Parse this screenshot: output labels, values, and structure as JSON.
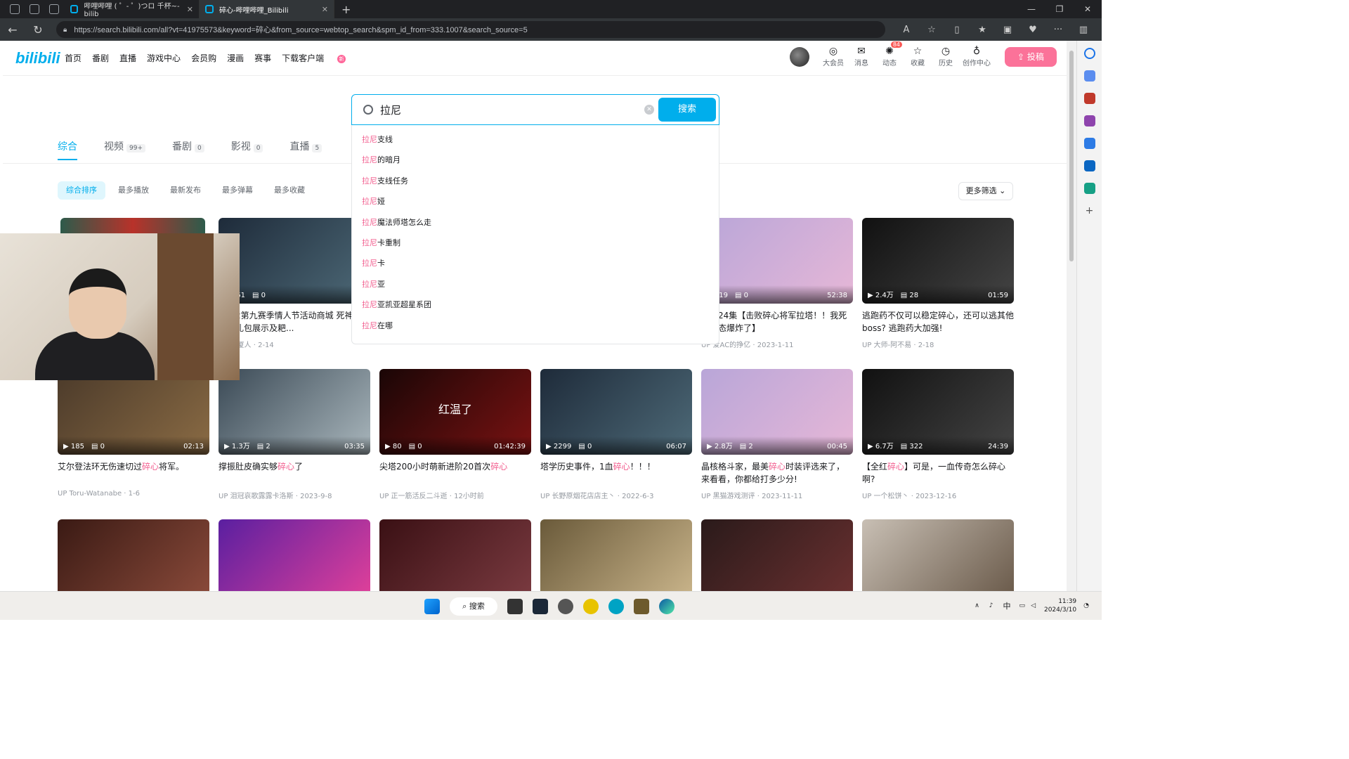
{
  "browser": {
    "tabs": [
      {
        "title": "哔哩哔哩 ( ゜- ゜)つロ 千杯~-bilib",
        "active": false
      },
      {
        "title": "碎心-哔哩哔哩_Bilibili",
        "active": true
      }
    ],
    "url": "https://search.bilibili.com/all?vt=41975573&keyword=碎心&from_source=webtop_search&spm_id_from=333.1007&search_source=5"
  },
  "header": {
    "logo": "bilibili",
    "nav": [
      "首页",
      "番剧",
      "直播",
      "游戏中心",
      "会员购",
      "漫画",
      "赛事",
      "下载客户端"
    ],
    "nav_badge": "新",
    "right_icons": [
      {
        "label": "大会员",
        "icon": "vip-icon"
      },
      {
        "label": "消息",
        "icon": "message-icon"
      },
      {
        "label": "动态",
        "icon": "dynamic-icon",
        "count": "84"
      },
      {
        "label": "收藏",
        "icon": "star-icon"
      },
      {
        "label": "历史",
        "icon": "clock-icon"
      },
      {
        "label": "创作中心",
        "icon": "bulb-icon"
      }
    ],
    "upload": "投稿"
  },
  "search": {
    "query": "拉尼",
    "button": "搜索",
    "suggestions": [
      {
        "hl": "拉尼",
        "rest": "支线"
      },
      {
        "hl": "拉尼",
        "rest": "的暗月"
      },
      {
        "hl": "拉尼",
        "rest": "支线任务"
      },
      {
        "hl": "拉尼",
        "rest": "娅"
      },
      {
        "hl": "拉尼",
        "rest": "魔法师塔怎么走"
      },
      {
        "hl": "拉尼",
        "rest": "卡重制"
      },
      {
        "hl": "拉尼",
        "rest": "卡"
      },
      {
        "hl": "拉尼",
        "rest": "亚"
      },
      {
        "hl": "拉尼",
        "rest": "亚凯亚超星系团"
      },
      {
        "hl": "拉尼",
        "rest": "在哪"
      }
    ]
  },
  "tabs": [
    {
      "label": "综合",
      "count": ""
    },
    {
      "label": "视频",
      "count": "99+"
    },
    {
      "label": "番剧",
      "count": "0"
    },
    {
      "label": "影视",
      "count": "0"
    },
    {
      "label": "直播",
      "count": "5"
    }
  ],
  "sorts": [
    "综合排序",
    "最多播放",
    "最新发布",
    "最多弹幕",
    "最多收藏"
  ],
  "more_filter": "更多筛选",
  "row1": [
    {
      "plays": "361",
      "danmaku": "0",
      "duration": "0",
      "title": "先锋2第九赛季情人节活动商城 死神碎心使者礼包展示及耙...",
      "author": "捕厦人",
      "date": "2-14",
      "col": 1
    },
    {
      "plays": "319",
      "danmaku": "0",
      "duration": "52:38",
      "title": "环第24集【击败碎心将军拉塔！！我死的心态爆炸了】",
      "author": "爱AC的挣亿",
      "date": "2023-1-11",
      "col": 4
    },
    {
      "plays": "2.4万",
      "danmaku": "28",
      "duration": "01:59",
      "title": "逃跑药不仅可以稳定碎心，还可以逃其他boss? 逃跑药大加强!",
      "author": "大师-阿不易",
      "date": "2-18",
      "col": 5
    }
  ],
  "row2": [
    {
      "plays": "185",
      "danmaku": "0",
      "duration": "02:13",
      "title_a": "艾尔登法环无伤速切过",
      "title_hl": "碎心",
      "title_b": "将军。",
      "author": "Toru-Watanabe",
      "date": "1-6"
    },
    {
      "plays": "1.3万",
      "danmaku": "2",
      "duration": "03:35",
      "title_a": "撑振肚皮确实够",
      "title_hl": "碎心",
      "title_b": "了",
      "author": "泪冠哀歌露露卡洛斯",
      "date": "2023-9-8"
    },
    {
      "plays": "80",
      "danmaku": "0",
      "duration": "01:42:39",
      "title_a": "尖塔200小时萌新进阶20首次",
      "title_hl": "碎心",
      "title_b": "",
      "author": "正一筋活反二斗逝",
      "date": "12小时前",
      "overlay": "红温了"
    },
    {
      "plays": "2299",
      "danmaku": "0",
      "duration": "06:07",
      "title_a": "塔学历史事件，1血",
      "title_hl": "碎心",
      "title_b": "！！！",
      "author": "长野原烟花店店主丶",
      "date": "2022-6-3"
    },
    {
      "plays": "2.8万",
      "danmaku": "2",
      "duration": "00:45",
      "title_a": "晶核格斗家，最美",
      "title_hl": "碎心",
      "title_b": "时装评选来了，来看看，你都给打多少分!",
      "author": "黑猫游戏测评",
      "date": "2023-11-11"
    },
    {
      "plays": "6.7万",
      "danmaku": "322",
      "duration": "24:39",
      "title_a": "【全红",
      "title_hl": "碎心",
      "title_b": "】可是，一血传奇怎么碎心啊?",
      "author": "一个松饼丶",
      "date": "2023-12-16"
    }
  ],
  "taskbar": {
    "search": "搜索",
    "time": "11:39",
    "date": "2024/3/10",
    "ime": "中"
  }
}
